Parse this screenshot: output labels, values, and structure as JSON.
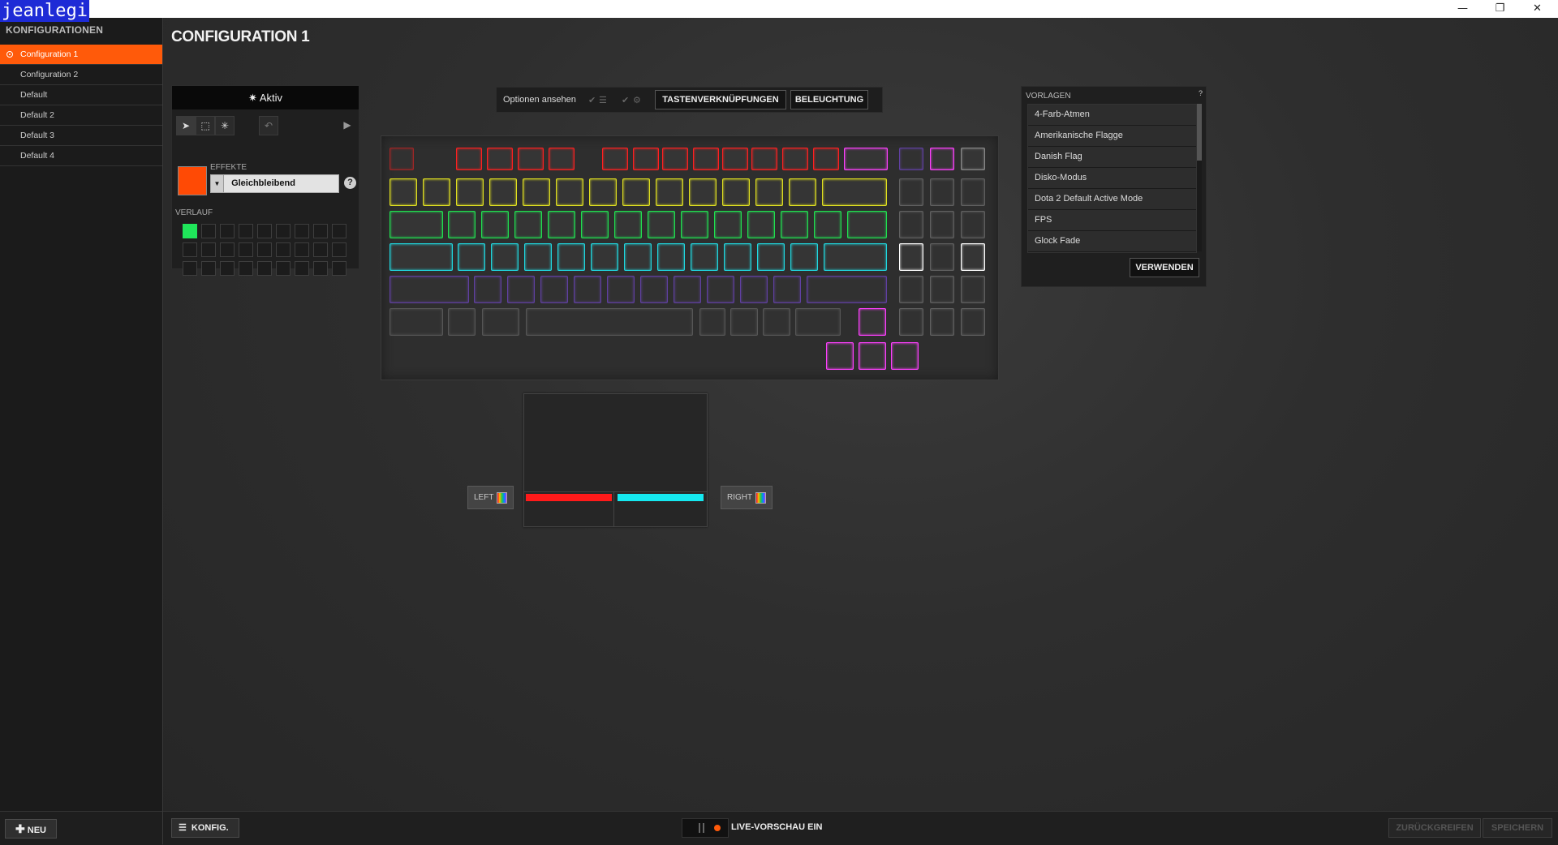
{
  "window": {
    "user_tag": "jeanlegi",
    "minimize": "—",
    "restore": "❐",
    "close": "✕"
  },
  "sidebar": {
    "title": "KONFIGURATIONEN",
    "configs": [
      "Configuration 1",
      "Configuration 2",
      "Default",
      "Default 2",
      "Default 3",
      "Default 4"
    ],
    "new_button": "NEU"
  },
  "main": {
    "title": "CONFIGURATION 1"
  },
  "effect_panel": {
    "status": "Aktiv",
    "effects_label": "EFFEKTE",
    "effect_value": "Gleichbleibend",
    "history_label": "VERLAUF",
    "current_color": "#ff4a05",
    "history_color": "#1fe65a"
  },
  "options": {
    "label": "Optionen ansehen",
    "shortcuts_button": "TASTENVERKNÜPFUNGEN",
    "lighting_button": "BELEUCHTUNG"
  },
  "keyboard": {
    "row_colors": [
      "#ff2020",
      "#e0e020",
      "#20e050",
      "#20d8e0",
      "#8a50ff",
      "#ff40ff"
    ],
    "arrow_color": "#ff40ff",
    "numpad_color": "#8a8a8a"
  },
  "touchpad": {
    "left_label": "LEFT",
    "right_label": "RIGHT",
    "left_color": "#ff1a1a",
    "right_color": "#15e8f0"
  },
  "presets": {
    "title": "VORLAGEN",
    "help": "?",
    "items": [
      "4-Farb-Atmen",
      "Amerikanische Flagge",
      "Danish Flag",
      "Disko-Modus",
      "Dota 2 Default Active Mode",
      "FPS",
      "Glock Fade"
    ],
    "apply_button": "VERWENDEN"
  },
  "bottom": {
    "konfig_button": "KONFIG.",
    "live_preview": "LIVE-VORSCHAU EIN",
    "revert_button": "ZURÜCKGREIFEN",
    "save_button": "SPEICHERN"
  },
  "icons": {
    "sun": "sun-icon",
    "pointer": "pointer-icon",
    "marquee": "marquee-select-icon",
    "wand": "magic-wand-icon",
    "undo": "undo-icon",
    "play": "play-icon",
    "list": "list-icon",
    "plus": "plus-icon"
  }
}
